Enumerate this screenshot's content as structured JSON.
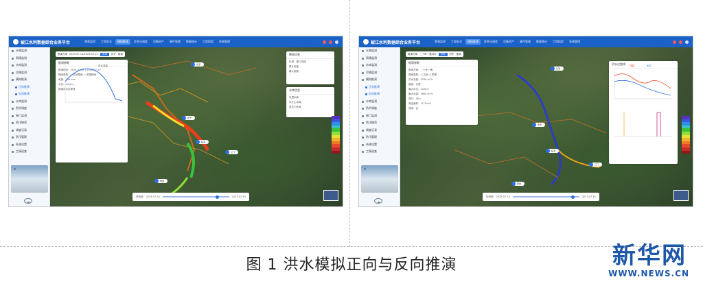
{
  "caption": "图 1  洪水模拟正向与反向推演",
  "brand": {
    "name": "新华网",
    "url": "WWW.NEWS.CN"
  },
  "app": {
    "title": "椒江水利数据综合业务平台",
    "nav": [
      "视频监控",
      "工程安全",
      "模拟推演",
      "综合化调度",
      "设备资产",
      "事件管理",
      "数据统计",
      "工程档案",
      "系统管理"
    ],
    "active_nav": "模拟推演"
  },
  "sidebar": {
    "items": [
      "水情监测",
      "雨情监测",
      "水库监测",
      "灾情监测",
      "模拟推演",
      "正向推演",
      "反向推演",
      "水库监测",
      "防洪调度",
      "闸门监测",
      "防汛物资",
      "调度记录",
      "防汛管理",
      "系统设置",
      "工情巡查"
    ]
  },
  "left_shot": {
    "toolbar": {
      "label": "推演方案",
      "value": "2023-07-14/2023-07-15",
      "btn": "查询",
      "opt1": "历史",
      "opt2": "推演"
    },
    "panel": {
      "title": "推演参数",
      "rows": [
        "推演时间：2023-07-14 / 2023-07-15",
        "降雨类型：○ 实测降雨  ○ 预报降雨",
        "雨量：100 mm",
        "水位：24.6 m",
        "推演洪水过程线"
      ],
      "series_name": "洪水流量"
    },
    "right_panel": {
      "title": "降雨信息",
      "rows": [
        "区域：椒江流域",
        "累计雨量",
        "最大雨强"
      ]
    },
    "right_panel2": {
      "title": "水库信息",
      "rows": [
        "长潭水库",
        "牛头山水库",
        "里石门水库"
      ]
    },
    "markers": [
      "长潭",
      "永宁",
      "临海",
      "三门",
      "黄岩"
    ],
    "timebar": {
      "label": "时间轴",
      "start": "2023-07-14",
      "end": "2023-07-15"
    }
  },
  "right_shot": {
    "toolbar": {
      "label": "推演方案",
      "value": "二十年一遇洪水",
      "btn": "查询",
      "opt1": "历史",
      "opt2": "推演"
    },
    "panel": {
      "title": "推演参数",
      "rows": [
        "推演方案：二十年一遇",
        "降雨类型：○ 实测  ○ 预报",
        "洪水流量：3200 m³/s",
        "断面：长潭",
        "最大水位：24.6 m",
        "最大流量：3600 m³/s",
        "历时：48 h",
        "淹没面积：12.3 km²",
        "溃坝：否"
      ]
    },
    "chart_panel": {
      "title": "洪水过程线",
      "legend": [
        "流量",
        "水位"
      ]
    },
    "markers": [
      "长潭",
      "永宁",
      "临海",
      "三门",
      "黄岩"
    ],
    "timebar": {
      "label": "时间轴",
      "start": "2023-07-14",
      "end": "2023-07-15"
    }
  }
}
